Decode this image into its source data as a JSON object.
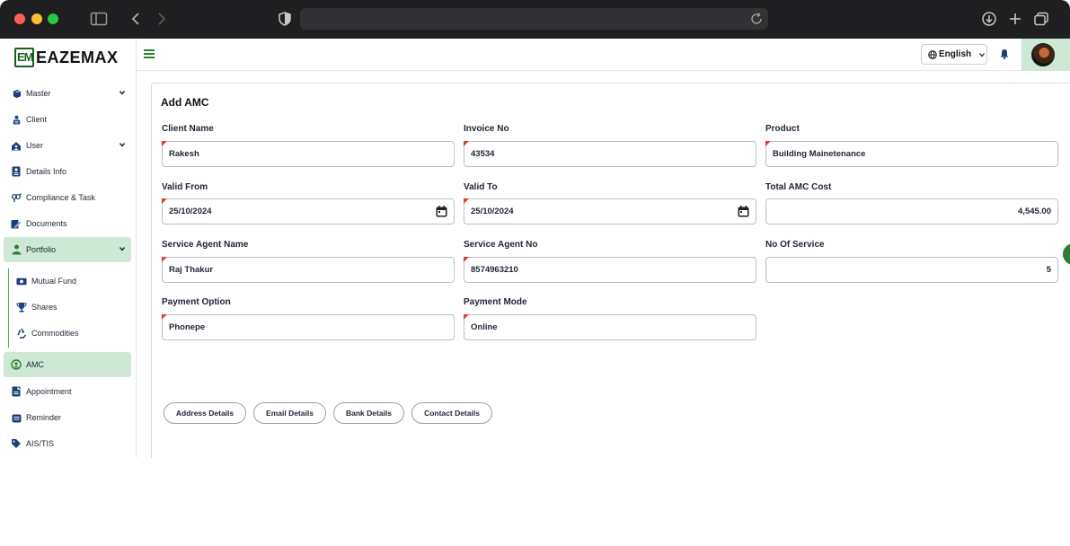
{
  "browser": {
    "icons": [
      "sidebar-toggle-icon",
      "back-icon",
      "forward-icon",
      "shield-icon",
      "reload-icon",
      "download-icon",
      "new-tab-icon",
      "tabs-icon"
    ]
  },
  "brand": {
    "name": "EAZEMAX",
    "mark": "EM",
    "color": "#1b5e20"
  },
  "sidebar": {
    "items": [
      {
        "label": "Master",
        "icon": "cube-icon",
        "chevron": true
      },
      {
        "label": "Client",
        "icon": "client-icon"
      },
      {
        "label": "User",
        "icon": "user-home-icon",
        "chevron": true
      },
      {
        "label": "Details Info",
        "icon": "id-card-icon"
      },
      {
        "label": "Compliance & Task",
        "icon": "gender-icon"
      },
      {
        "label": "Documents",
        "icon": "documents-icon"
      },
      {
        "label": "Portfolio",
        "icon": "portfolio-icon",
        "chevron": true,
        "expanded": true
      },
      {
        "label": "Mutual Fund",
        "icon": "money-icon",
        "sub": true
      },
      {
        "label": "Shares",
        "icon": "trophy-icon",
        "sub": true
      },
      {
        "label": "Commodities",
        "icon": "recycle-icon",
        "sub": true
      },
      {
        "label": "AMC",
        "icon": "amc-icon",
        "active": true
      },
      {
        "label": "Appointment",
        "icon": "appointment-icon"
      },
      {
        "label": "Reminder",
        "icon": "reminder-icon"
      },
      {
        "label": "AIS/TIS",
        "icon": "tag-icon"
      }
    ]
  },
  "header": {
    "language": "English"
  },
  "form": {
    "title": "Add AMC",
    "fields": {
      "client_name": {
        "label": "Client Name",
        "value": "Rakesh"
      },
      "invoice_no": {
        "label": "Invoice No",
        "value": "43534"
      },
      "product": {
        "label": "Product",
        "value": "Building Mainetenance"
      },
      "valid_from": {
        "label": "Valid From",
        "value": "25/10/2024"
      },
      "valid_to": {
        "label": "Valid To",
        "value": "25/10/2024"
      },
      "total_amc_cost": {
        "label": "Total AMC Cost",
        "value": "4,545.00"
      },
      "service_agent_name": {
        "label": "Service Agent Name",
        "value": "Raj Thakur"
      },
      "service_agent_no": {
        "label": "Service Agent No",
        "value": "8574963210"
      },
      "no_of_service": {
        "label": "No Of Service",
        "value": "5"
      },
      "payment_option": {
        "label": "Payment Option",
        "value": "Phonepe"
      },
      "payment_mode": {
        "label": "Payment Mode",
        "value": "Online"
      }
    },
    "buttons": {
      "address": "Address Details",
      "email": "Email Details",
      "bank": "Bank Details",
      "contact": "Contact Details"
    }
  },
  "colors": {
    "accent": "#2e7d32",
    "active_bg": "#cde9d5",
    "required": "#e53935"
  }
}
